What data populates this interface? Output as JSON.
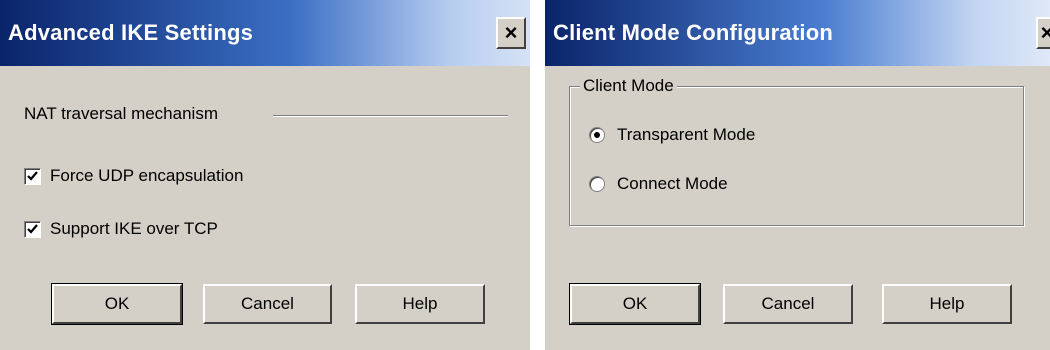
{
  "ike_dialog": {
    "title": "Advanced IKE Settings",
    "close_label": "×",
    "section_label": "NAT traversal mechanism",
    "options": [
      {
        "label": "Force UDP encapsulation",
        "checked": true
      },
      {
        "label": "Support IKE over TCP",
        "checked": true
      }
    ],
    "buttons": {
      "ok": "OK",
      "cancel": "Cancel",
      "help": "Help"
    }
  },
  "client_dialog": {
    "title": "Client Mode Configuration",
    "close_label": "×",
    "group_label": "Client Mode",
    "options": [
      {
        "label": "Transparent Mode",
        "selected": true
      },
      {
        "label": "Connect Mode",
        "selected": false
      }
    ],
    "buttons": {
      "ok": "OK",
      "cancel": "Cancel",
      "help": "Help"
    }
  }
}
